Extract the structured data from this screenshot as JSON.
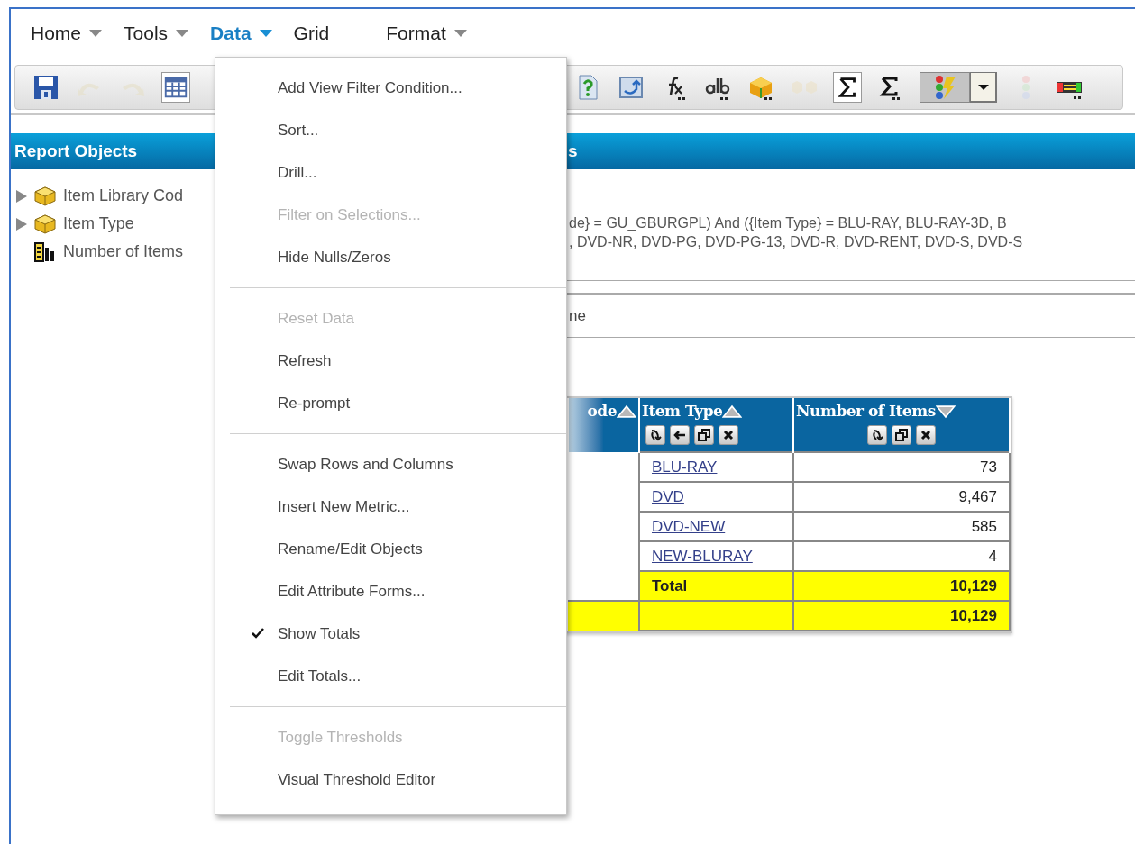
{
  "menu_bar": [
    {
      "label": "Home",
      "dropdown": true,
      "selected": false
    },
    {
      "label": "Tools",
      "dropdown": true,
      "selected": false
    },
    {
      "label": "Data",
      "dropdown": true,
      "selected": true
    },
    {
      "label": "Grid",
      "dropdown": false,
      "selected": false
    },
    {
      "label": "Format",
      "dropdown": true,
      "selected": false
    }
  ],
  "toolbar": [
    {
      "kind": "save",
      "disabled": false,
      "pressed": false
    },
    {
      "kind": "undo",
      "disabled": true,
      "pressed": false
    },
    {
      "kind": "redo",
      "disabled": true,
      "pressed": false
    },
    {
      "kind": "grid",
      "disabled": false,
      "pressed": true
    },
    {
      "kind": "help",
      "disabled": false,
      "pressed": false
    },
    {
      "kind": "refresh",
      "disabled": false,
      "pressed": false
    },
    {
      "kind": "formula",
      "disabled": false,
      "pressed": false
    },
    {
      "kind": "rename",
      "disabled": false,
      "pressed": false
    },
    {
      "kind": "cube",
      "disabled": false,
      "pressed": false
    },
    {
      "kind": "cubes",
      "disabled": true,
      "pressed": false
    },
    {
      "kind": "sum",
      "disabled": false,
      "pressed": true
    },
    {
      "kind": "subtotal",
      "disabled": false,
      "pressed": false
    },
    {
      "kind": "thresholds",
      "disabled": false,
      "pressed": true
    },
    {
      "kind": "dropdown",
      "disabled": false
    },
    {
      "kind": "stoplight",
      "disabled": true,
      "pressed": false
    },
    {
      "kind": "banding",
      "disabled": false,
      "pressed": false
    }
  ],
  "report_objects": {
    "title": "Report Objects",
    "items": [
      {
        "label": "Item Library Cod",
        "kind": "attribute",
        "expandable": true
      },
      {
        "label": "Item Type",
        "kind": "attribute",
        "expandable": true
      },
      {
        "label": "Number of Items",
        "kind": "metric",
        "expandable": false
      }
    ]
  },
  "report": {
    "title": "s",
    "filter": [
      "de} = GU_GBURGPL) And ({Item Type} = BLU-RAY, BLU-RAY-3D, B",
      ", DVD-NR, DVD-PG, DVD-PG-13, DVD-R, DVD-RENT, DVD-S, DVD-S"
    ],
    "row_label": "ne",
    "table": {
      "columns": [
        {
          "label": "ode",
          "descending": false
        },
        {
          "label": "Item Type",
          "descending": false,
          "tools": [
            {
              "kind": "pivot"
            },
            {
              "kind": "move-left"
            },
            {
              "kind": "window"
            },
            {
              "kind": "remove"
            }
          ]
        },
        {
          "label": "Number of Items",
          "descending": true,
          "tools": [
            {
              "kind": "pivot"
            },
            {
              "kind": "window"
            },
            {
              "kind": "remove"
            }
          ]
        }
      ],
      "rows": [
        {
          "kind": "data",
          "item_type": "BLU-RAY",
          "count": "73"
        },
        {
          "kind": "data",
          "item_type": "DVD",
          "count": "9,467"
        },
        {
          "kind": "data",
          "item_type": "DVD-NEW",
          "count": "585"
        },
        {
          "kind": "data",
          "item_type": "NEW-BLURAY",
          "count": "4"
        },
        {
          "kind": "subtotal",
          "item_type": "Total",
          "count": "10,129"
        },
        {
          "kind": "grand_total",
          "count": "10,129"
        }
      ]
    }
  },
  "data_menu": {
    "items": [
      {
        "kind": "item",
        "label": "Add View Filter Condition...",
        "disabled": false,
        "checked": false
      },
      {
        "kind": "item",
        "label": "Sort...",
        "disabled": false,
        "checked": false
      },
      {
        "kind": "item",
        "label": "Drill...",
        "disabled": false,
        "checked": false
      },
      {
        "kind": "item",
        "label": "Filter on Selections...",
        "disabled": true,
        "checked": false
      },
      {
        "kind": "item",
        "label": "Hide Nulls/Zeros",
        "disabled": false,
        "checked": false
      },
      {
        "kind": "separator"
      },
      {
        "kind": "item",
        "label": "Reset Data",
        "disabled": true,
        "checked": false
      },
      {
        "kind": "item",
        "label": "Refresh",
        "disabled": false,
        "checked": false
      },
      {
        "kind": "item",
        "label": "Re-prompt",
        "disabled": false,
        "checked": false
      },
      {
        "kind": "separator"
      },
      {
        "kind": "item",
        "label": "Swap Rows and Columns",
        "disabled": false,
        "checked": false
      },
      {
        "kind": "item",
        "label": "Insert New Metric...",
        "disabled": false,
        "checked": false
      },
      {
        "kind": "item",
        "label": "Rename/Edit Objects",
        "disabled": false,
        "checked": false
      },
      {
        "kind": "item",
        "label": "Edit Attribute Forms...",
        "disabled": false,
        "checked": false
      },
      {
        "kind": "item",
        "label": "Show Totals",
        "disabled": false,
        "checked": true
      },
      {
        "kind": "item",
        "label": "Edit Totals...",
        "disabled": false,
        "checked": false
      },
      {
        "kind": "separator"
      },
      {
        "kind": "item",
        "label": "Toggle Thresholds",
        "disabled": true,
        "checked": false
      },
      {
        "kind": "item",
        "label": "Visual Threshold Editor",
        "disabled": false,
        "checked": false
      }
    ]
  }
}
